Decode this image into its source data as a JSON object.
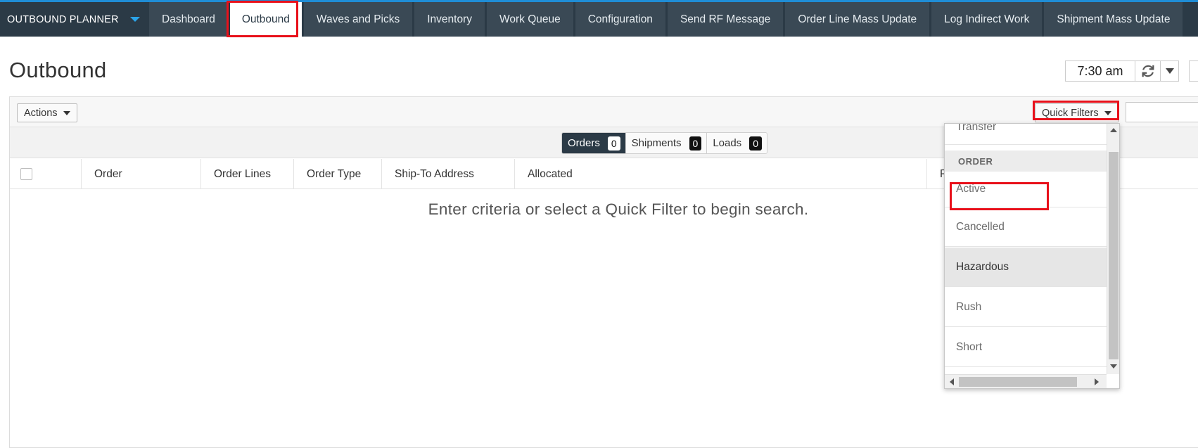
{
  "app": {
    "name": "OUTBOUND PLANNER"
  },
  "nav": {
    "tabs": [
      {
        "label": "Dashboard"
      },
      {
        "label": "Outbound"
      },
      {
        "label": "Waves and Picks"
      },
      {
        "label": "Inventory"
      },
      {
        "label": "Work Queue"
      },
      {
        "label": "Configuration"
      },
      {
        "label": "Send RF Message"
      },
      {
        "label": "Order Line Mass Update"
      },
      {
        "label": "Log Indirect Work"
      },
      {
        "label": "Shipment Mass Update"
      }
    ],
    "active_tab": "Outbound"
  },
  "page": {
    "title": "Outbound",
    "time": "7:30 am"
  },
  "toolbar": {
    "actions_label": "Actions",
    "quick_filters_label": "Quick Filters",
    "search_value": ""
  },
  "segments": [
    {
      "label": "Orders",
      "count": "0",
      "active": true
    },
    {
      "label": "Shipments",
      "count": "0",
      "active": false
    },
    {
      "label": "Loads",
      "count": "0",
      "active": false
    }
  ],
  "grid": {
    "columns": [
      "Order",
      "Order Lines",
      "Order Type",
      "Ship-To Address",
      "Allocated",
      "P"
    ],
    "empty_message": "Enter criteria or select a Quick Filter to begin search."
  },
  "quick_filters": {
    "items_before_group": [
      "Transfer"
    ],
    "group_label": "ORDER",
    "items": [
      "Active",
      "Cancelled",
      "Hazardous",
      "Rush",
      "Short"
    ],
    "hovered": "Hazardous"
  },
  "colors": {
    "nav_bg": "#2b3a46",
    "nav_tab_bg": "#3a4955",
    "accent": "#1f8dd6",
    "highlight": "#e8101a"
  }
}
